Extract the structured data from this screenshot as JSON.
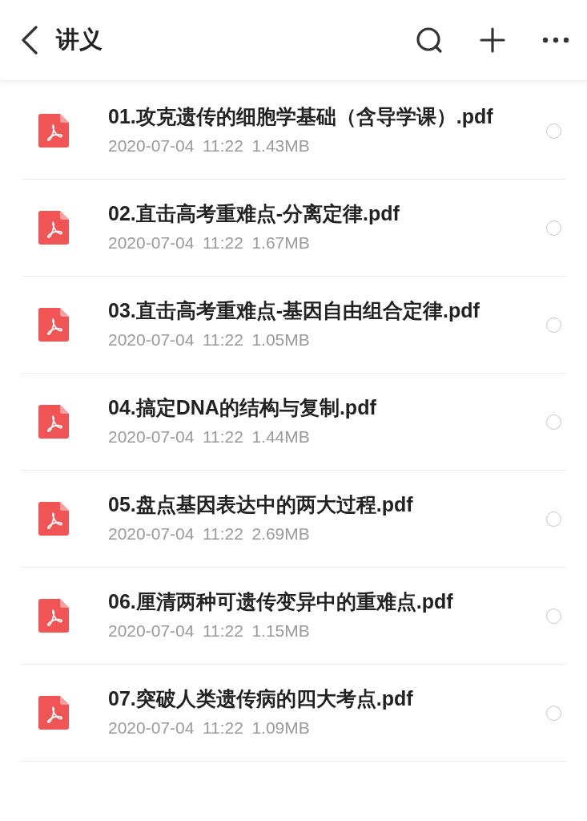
{
  "header": {
    "title": "讲义"
  },
  "files": [
    {
      "name": "01.攻克遗传的细胞学基础（含导学课）.pdf",
      "date": "2020-07-04",
      "time": "11:22",
      "size": "1.43MB",
      "selected": false
    },
    {
      "name": "02.直击高考重难点-分离定律.pdf",
      "date": "2020-07-04",
      "time": "11:22",
      "size": "1.67MB",
      "selected": false
    },
    {
      "name": "03.直击高考重难点-基因自由组合定律.pdf",
      "date": "2020-07-04",
      "time": "11:22",
      "size": "1.05MB",
      "selected": false
    },
    {
      "name": "04.搞定DNA的结构与复制.pdf",
      "date": "2020-07-04",
      "time": "11:22",
      "size": "1.44MB",
      "selected": false
    },
    {
      "name": "05.盘点基因表达中的两大过程.pdf",
      "date": "2020-07-04",
      "time": "11:22",
      "size": "2.69MB",
      "selected": false
    },
    {
      "name": "06.厘清两种可遗传变异中的重难点.pdf",
      "date": "2020-07-04",
      "time": "11:22",
      "size": "1.15MB",
      "selected": false
    },
    {
      "name": "07.突破人类遗传病的四大考点.pdf",
      "date": "2020-07-04",
      "time": "11:22",
      "size": "1.09MB",
      "selected": false
    }
  ]
}
